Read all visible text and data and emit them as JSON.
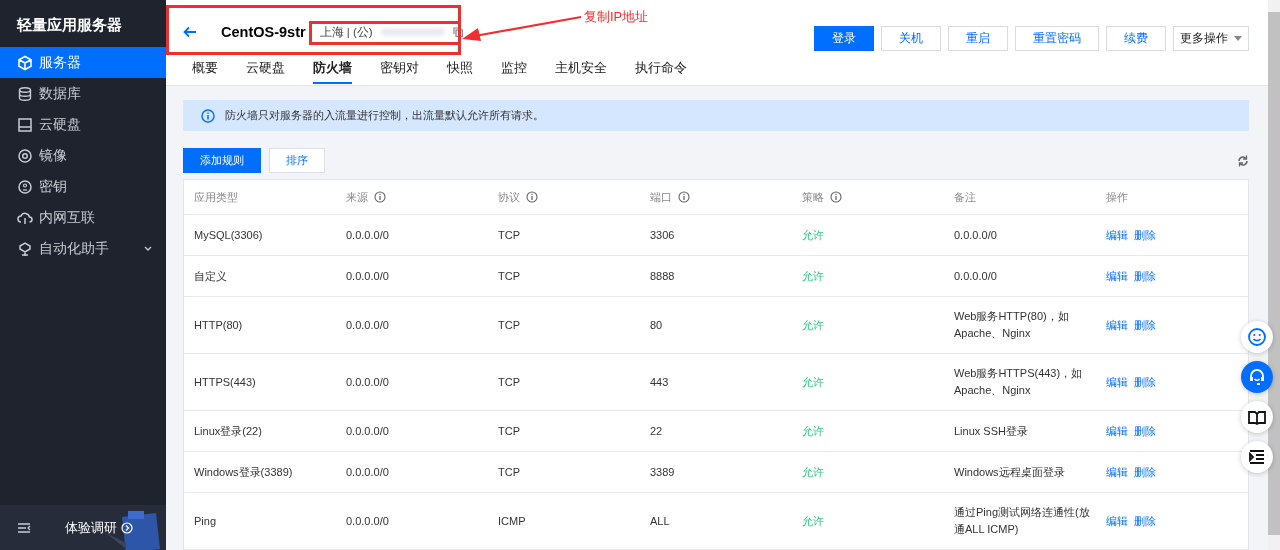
{
  "sidebar": {
    "title": "轻量应用服务器",
    "items": [
      {
        "label": "服务器",
        "selected": true,
        "has_submenu": false
      },
      {
        "label": "数据库",
        "selected": false,
        "has_submenu": false
      },
      {
        "label": "云硬盘",
        "selected": false,
        "has_submenu": false
      },
      {
        "label": "镜像",
        "selected": false,
        "has_submenu": false
      },
      {
        "label": "密钥",
        "selected": false,
        "has_submenu": false
      },
      {
        "label": "内网互联",
        "selected": false,
        "has_submenu": false
      },
      {
        "label": "自动化助手",
        "selected": false,
        "has_submenu": true
      }
    ],
    "footer": {
      "label": "体验调研"
    }
  },
  "header": {
    "title": "CentOS-9str",
    "region": "上海 | (公)",
    "actions": [
      {
        "label": "登录",
        "primary": true,
        "dropdown": false
      },
      {
        "label": "关机",
        "primary": false,
        "dropdown": false
      },
      {
        "label": "重启",
        "primary": false,
        "dropdown": false
      },
      {
        "label": "重置密码",
        "primary": false,
        "dropdown": false
      },
      {
        "label": "续费",
        "primary": false,
        "dropdown": false
      },
      {
        "label": "更多操作",
        "primary": false,
        "dropdown": true
      }
    ]
  },
  "tabs": [
    {
      "label": "概要",
      "selected": false
    },
    {
      "label": "云硬盘",
      "selected": false
    },
    {
      "label": "防火墙",
      "selected": true
    },
    {
      "label": "密钥对",
      "selected": false
    },
    {
      "label": "快照",
      "selected": false
    },
    {
      "label": "监控",
      "selected": false
    },
    {
      "label": "主机安全",
      "selected": false
    },
    {
      "label": "执行命令",
      "selected": false
    }
  ],
  "notice": "防火墙只对服务器的入流量进行控制，出流量默认允许所有请求。",
  "toolbar": [
    {
      "label": "添加规则",
      "primary": true
    },
    {
      "label": "排序",
      "primary": false
    }
  ],
  "table": {
    "columns": [
      {
        "label": "应用类型",
        "info": false,
        "kind": "text"
      },
      {
        "label": "来源",
        "info": true,
        "kind": "text"
      },
      {
        "label": "协议",
        "info": true,
        "kind": "text"
      },
      {
        "label": "端口",
        "info": true,
        "kind": "text"
      },
      {
        "label": "策略",
        "info": true,
        "kind": "policy"
      },
      {
        "label": "备注",
        "info": false,
        "kind": "note"
      },
      {
        "label": "操作",
        "info": false,
        "kind": "actions"
      }
    ],
    "rows": [
      {
        "cells": [
          "MySQL(3306)",
          "0.0.0.0/0",
          "TCP",
          "3306",
          "允许",
          "0.0.0.0/0",
          [
            "编辑",
            "删除"
          ]
        ]
      },
      {
        "cells": [
          "自定义",
          "0.0.0.0/0",
          "TCP",
          "8888",
          "允许",
          "0.0.0.0/0",
          [
            "编辑",
            "删除"
          ]
        ]
      },
      {
        "cells": [
          "HTTP(80)",
          "0.0.0.0/0",
          "TCP",
          "80",
          "允许",
          "Web服务HTTP(80)，如Apache、Nginx",
          [
            "编辑",
            "删除"
          ]
        ]
      },
      {
        "cells": [
          "HTTPS(443)",
          "0.0.0.0/0",
          "TCP",
          "443",
          "允许",
          "Web服务HTTPS(443)，如Apache、Nginx",
          [
            "编辑",
            "删除"
          ]
        ]
      },
      {
        "cells": [
          "Linux登录(22)",
          "0.0.0.0/0",
          "TCP",
          "22",
          "允许",
          "Linux SSH登录",
          [
            "编辑",
            "删除"
          ]
        ]
      },
      {
        "cells": [
          "Windows登录(3389)",
          "0.0.0.0/0",
          "TCP",
          "3389",
          "允许",
          "Windows远程桌面登录",
          [
            "编辑",
            "删除"
          ]
        ]
      },
      {
        "cells": [
          "Ping",
          "0.0.0.0/0",
          "ICMP",
          "ALL",
          "允许",
          "通过Ping测试网络连通性(放通ALL ICMP)",
          [
            "编辑",
            "删除"
          ]
        ]
      }
    ]
  },
  "float_buttons": [
    {
      "selected": false
    },
    {
      "selected": true
    },
    {
      "selected": false
    },
    {
      "selected": false
    }
  ],
  "annotation": {
    "label": "复制IP地址"
  }
}
